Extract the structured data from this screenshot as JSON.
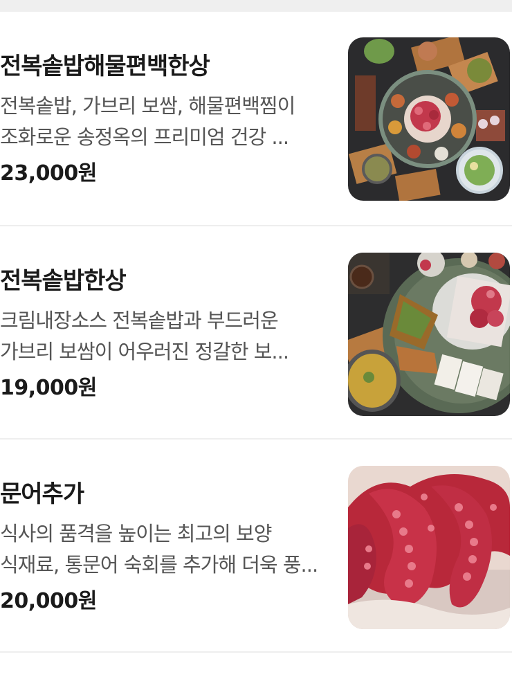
{
  "menu_items": [
    {
      "name": "전복솥밥해물편백한상",
      "description": "전복솥밥, 가브리 보쌈, 해물편백찜이 조화로운 송정옥의 프리미엄 건강 ...",
      "price": "23,000원",
      "image_icon": "seafood-table-photo"
    },
    {
      "name": "전복솥밥한상",
      "description": "크림내장소스 전복솥밥과 부드러운 가브리 보쌈이 어우러진 정갈한 보...",
      "price": "19,000원",
      "image_icon": "bossam-table-photo"
    },
    {
      "name": "문어추가",
      "description": "식사의 품격을 높이는 최고의 보양 식재료, 통문어 숙회를 추가해 더욱 풍...",
      "price": "20,000원",
      "image_icon": "octopus-photo"
    }
  ]
}
